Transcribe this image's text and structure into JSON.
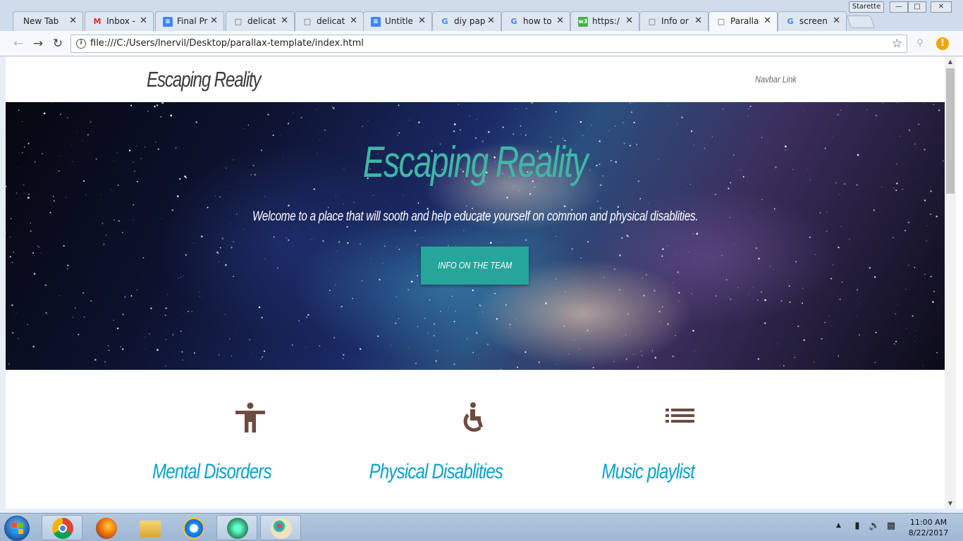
{
  "browser": {
    "user_name": "Starette",
    "tabs": [
      {
        "label": "New Tab",
        "icon": "none"
      },
      {
        "label": "Inbox -",
        "icon": "gmail-icon"
      },
      {
        "label": "Final Pr",
        "icon": "docs-icon"
      },
      {
        "label": "delicat",
        "icon": "page-icon"
      },
      {
        "label": "delicat",
        "icon": "page-icon"
      },
      {
        "label": "Untitle",
        "icon": "docs-icon"
      },
      {
        "label": "diy pap",
        "icon": "google-icon"
      },
      {
        "label": "how to",
        "icon": "google-icon"
      },
      {
        "label": "https:/",
        "icon": "w3-icon"
      },
      {
        "label": "Info or",
        "icon": "page-icon"
      },
      {
        "label": "Paralla",
        "icon": "page-icon"
      },
      {
        "label": "screen",
        "icon": "google-icon"
      }
    ],
    "active_tab": 10,
    "url": "file:///C:/Users/lnervil/Desktop/parallax-template/index.html"
  },
  "page": {
    "brand": "Escaping Reality",
    "nav_link": "Navbar Link",
    "hero": {
      "title": "Escaping Reality",
      "subtitle": "Welcome to a place that will sooth and help educate yourself on common and physical disablities.",
      "button": "Info on the team"
    },
    "features": [
      {
        "icon": "accessibility-icon",
        "title": "Mental Disorders"
      },
      {
        "icon": "wheelchair-icon",
        "title": "Physical Disablities"
      },
      {
        "icon": "list-icon",
        "title": "Music playlist"
      }
    ]
  },
  "taskbar": {
    "apps": [
      "chrome-icon",
      "firefox-icon",
      "file-explorer-icon",
      "internet-explorer-icon",
      "atom-icon",
      "paint-icon"
    ],
    "clock_time": "11:00 AM",
    "clock_date": "8/22/2017"
  },
  "colors": {
    "accent_teal": "#26a69a",
    "hero_title": "#3fb7a6",
    "feature_title": "#0aa1c9",
    "feature_icon": "#6d4c41"
  }
}
